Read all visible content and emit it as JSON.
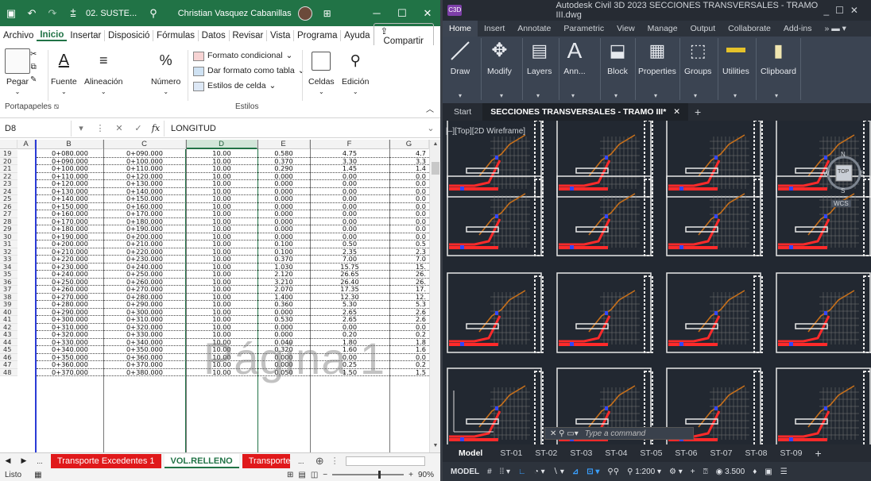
{
  "excel": {
    "file_name": "02. SUSTE...",
    "user_name": "Christian Vasquez Cabanillas",
    "menu_tabs": [
      "Archivo",
      "Inicio",
      "Insertar",
      "Disposició",
      "Fórmulas",
      "Datos",
      "Revisar",
      "Vista",
      "Programa",
      "Ayuda"
    ],
    "active_tab": "Inicio",
    "share_label": "Compartir",
    "ribbon": {
      "paste": "Pegar",
      "font": "Fuente",
      "alignment": "Alineación",
      "number": "Número",
      "conditional_format": "Formato condicional",
      "format_as_table": "Dar formato como tabla",
      "cell_styles": "Estilos de celda",
      "cells": "Celdas",
      "editing": "Edición",
      "clipboard_group": "Portapapeles",
      "styles_group": "Estilos"
    },
    "name_box": "D8",
    "formula_value": "LONGITUD",
    "columns": [
      "A",
      "B",
      "C",
      "D",
      "E",
      "F",
      "G"
    ],
    "selected_column": "D",
    "rows": [
      {
        "n": "19",
        "b": "0+080.000",
        "c": "0+090.000",
        "d": "10.00",
        "e": "0.580",
        "f": "4.75",
        "g": "4.7"
      },
      {
        "n": "20",
        "b": "0+090.000",
        "c": "0+100.000",
        "d": "10.00",
        "e": "0.370",
        "f": "3.30",
        "g": "3.3"
      },
      {
        "n": "21",
        "b": "0+100.000",
        "c": "0+110.000",
        "d": "10.00",
        "e": "0.290",
        "f": "1.45",
        "g": "1.4"
      },
      {
        "n": "22",
        "b": "0+110.000",
        "c": "0+120.000",
        "d": "10.00",
        "e": "0.000",
        "f": "0.00",
        "g": "0.0"
      },
      {
        "n": "23",
        "b": "0+120.000",
        "c": "0+130.000",
        "d": "10.00",
        "e": "0.000",
        "f": "0.00",
        "g": "0.0"
      },
      {
        "n": "24",
        "b": "0+130.000",
        "c": "0+140.000",
        "d": "10.00",
        "e": "0.000",
        "f": "0.00",
        "g": "0.0"
      },
      {
        "n": "25",
        "b": "0+140.000",
        "c": "0+150.000",
        "d": "10.00",
        "e": "0.000",
        "f": "0.00",
        "g": "0.0"
      },
      {
        "n": "26",
        "b": "0+150.000",
        "c": "0+160.000",
        "d": "10.00",
        "e": "0.000",
        "f": "0.00",
        "g": "0.0"
      },
      {
        "n": "27",
        "b": "0+160.000",
        "c": "0+170.000",
        "d": "10.00",
        "e": "0.000",
        "f": "0.00",
        "g": "0.0"
      },
      {
        "n": "28",
        "b": "0+170.000",
        "c": "0+180.000",
        "d": "10.00",
        "e": "0.000",
        "f": "0.00",
        "g": "0.0"
      },
      {
        "n": "29",
        "b": "0+180.000",
        "c": "0+190.000",
        "d": "10.00",
        "e": "0.000",
        "f": "0.00",
        "g": "0.0"
      },
      {
        "n": "30",
        "b": "0+190.000",
        "c": "0+200.000",
        "d": "10.00",
        "e": "0.000",
        "f": "0.00",
        "g": "0.0"
      },
      {
        "n": "31",
        "b": "0+200.000",
        "c": "0+210.000",
        "d": "10.00",
        "e": "0.100",
        "f": "0.50",
        "g": "0.5"
      },
      {
        "n": "32",
        "b": "0+210.000",
        "c": "0+220.000",
        "d": "10.00",
        "e": "0.100",
        "f": "2.35",
        "g": "2.3"
      },
      {
        "n": "33",
        "b": "0+220.000",
        "c": "0+230.000",
        "d": "10.00",
        "e": "0.370",
        "f": "7.00",
        "g": "7.0"
      },
      {
        "n": "34",
        "b": "0+230.000",
        "c": "0+240.000",
        "d": "10.00",
        "e": "1.030",
        "f": "15.75",
        "g": "15."
      },
      {
        "n": "35",
        "b": "0+240.000",
        "c": "0+250.000",
        "d": "10.00",
        "e": "2.120",
        "f": "26.65",
        "g": "26."
      },
      {
        "n": "36",
        "b": "0+250.000",
        "c": "0+260.000",
        "d": "10.00",
        "e": "3.210",
        "f": "26.40",
        "g": "26."
      },
      {
        "n": "37",
        "b": "0+260.000",
        "c": "0+270.000",
        "d": "10.00",
        "e": "2.070",
        "f": "17.35",
        "g": "17."
      },
      {
        "n": "38",
        "b": "0+270.000",
        "c": "0+280.000",
        "d": "10.00",
        "e": "1.400",
        "f": "12.30",
        "g": "12."
      },
      {
        "n": "39",
        "b": "0+280.000",
        "c": "0+290.000",
        "d": "10.00",
        "e": "0.360",
        "f": "5.30",
        "g": "5.3"
      },
      {
        "n": "40",
        "b": "0+290.000",
        "c": "0+300.000",
        "d": "10.00",
        "e": "0.000",
        "f": "2.65",
        "g": "2.6"
      },
      {
        "n": "41",
        "b": "0+300.000",
        "c": "0+310.000",
        "d": "10.00",
        "e": "0.530",
        "f": "2.65",
        "g": "2.6"
      },
      {
        "n": "42",
        "b": "0+310.000",
        "c": "0+320.000",
        "d": "10.00",
        "e": "0.000",
        "f": "0.00",
        "g": "0.0"
      },
      {
        "n": "43",
        "b": "0+320.000",
        "c": "0+330.000",
        "d": "10.00",
        "e": "0.000",
        "f": "0.20",
        "g": "0.2"
      },
      {
        "n": "44",
        "b": "0+330.000",
        "c": "0+340.000",
        "d": "10.00",
        "e": "0.040",
        "f": "1.80",
        "g": "1.8"
      },
      {
        "n": "45",
        "b": "0+340.000",
        "c": "0+350.000",
        "d": "10.00",
        "e": "0.320",
        "f": "1.60",
        "g": "1.6"
      },
      {
        "n": "46",
        "b": "0+350.000",
        "c": "0+360.000",
        "d": "10.00",
        "e": "0.000",
        "f": "0.00",
        "g": "0.0"
      },
      {
        "n": "47",
        "b": "0+360.000",
        "c": "0+370.000",
        "d": "10.00",
        "e": "0.000",
        "f": "0.25",
        "g": "0.2"
      },
      {
        "n": "48",
        "b": "0+370.000",
        "c": "0+380.000",
        "d": "10.00",
        "e": "0.050",
        "f": "1.50",
        "g": "1.5"
      }
    ],
    "page_watermark": "Página 1",
    "sheet_tabs": [
      "Transporte Excedentes 1",
      "VOL.RELLENO",
      "Transporte"
    ],
    "active_sheet": "VOL.RELLENO",
    "more_sheets": "...",
    "status_text": "Listo",
    "zoom": "90%",
    "accent_color": "#217346",
    "tab_color": "#e0191b"
  },
  "civil3d": {
    "app_badge": "C3D",
    "window_title": "Autodesk Civil 3D 2023   SECCIONES TRANSVERSALES - TRAMO III.dwg",
    "menu_tabs": [
      "Home",
      "Insert",
      "Annotate",
      "Parametric",
      "View",
      "Manage",
      "Output",
      "Collaborate",
      "Add-ins"
    ],
    "active_tab": "Home",
    "ribbon_buttons": [
      "Draw",
      "Modify",
      "Layers",
      "Ann...",
      "Block",
      "Properties",
      "Groups",
      "Utilities",
      "Clipboard"
    ],
    "start_tab": "Start",
    "document_tab": "SECCIONES TRANSVERSALES - TRAMO III*",
    "viewport_label": "[–][Top][2D Wireframe]",
    "viewcube": {
      "top": "TOP",
      "north": "N",
      "south": "S",
      "west": "W",
      "east": "E",
      "wcs": "WCS"
    },
    "command_placeholder": "Type a command",
    "layout_tabs": [
      "Model",
      "ST-01",
      "ST-02",
      "ST-03",
      "ST-04",
      "ST-05",
      "ST-06",
      "ST-07",
      "ST-08",
      "ST-09"
    ],
    "status": {
      "model": "MODEL",
      "scale": "1:200",
      "lineweight": "3.500"
    }
  }
}
